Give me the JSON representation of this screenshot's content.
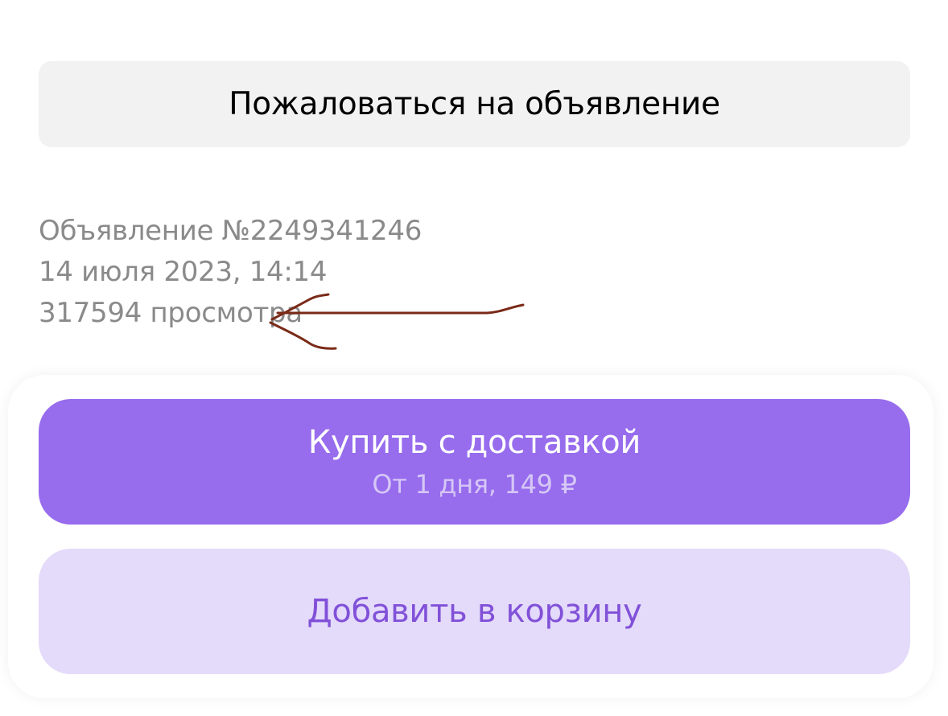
{
  "report": {
    "label": "Пожаловаться на объявление"
  },
  "listing": {
    "number": "Объявление №2249341246",
    "date": "14 июля 2023, 14:14",
    "views": "317594 просмотра"
  },
  "buy": {
    "title": "Купить с доставкой",
    "subtitle": "От 1 дня, 149 ₽"
  },
  "cart": {
    "label": "Добавить в корзину"
  },
  "colors": {
    "primary": "#976ced",
    "secondary_bg": "#e4dafa",
    "secondary_text": "#8151d8",
    "report_bg": "#f2f2f2",
    "meta_text": "#8a8a8a",
    "annotation": "#7a2a18"
  },
  "annotation": {
    "icon": "hand-drawn-arrow-icon"
  }
}
